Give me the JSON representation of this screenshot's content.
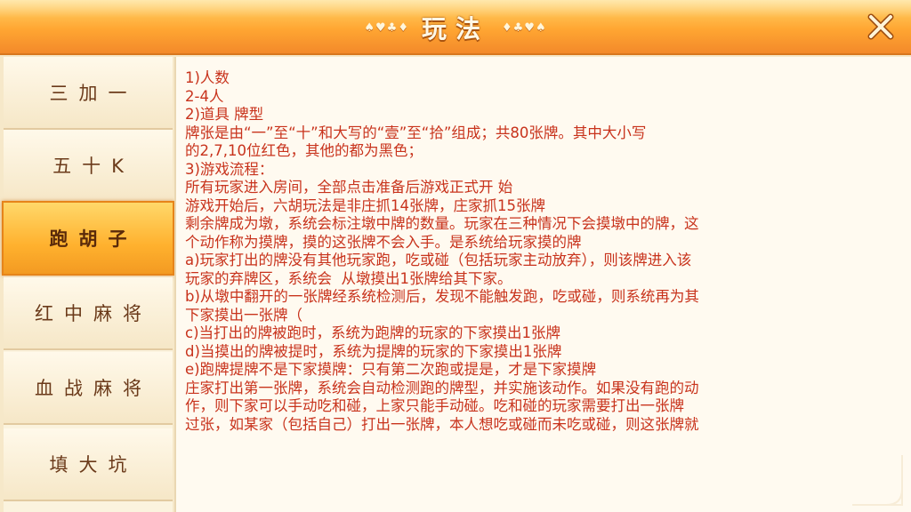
{
  "header": {
    "title": "玩法",
    "left_ornament": "♠♥♣♦",
    "right_ornament": "♦♣♥♠"
  },
  "sidebar": {
    "items": [
      {
        "label": "三加一",
        "active": false
      },
      {
        "label": "五十K",
        "active": false
      },
      {
        "label": "跑胡子",
        "active": true
      },
      {
        "label": "红中麻将",
        "active": false
      },
      {
        "label": "血战麻将",
        "active": false
      },
      {
        "label": "填大坑",
        "active": false
      }
    ]
  },
  "rules": {
    "lines": [
      "1)人数",
      "2-4人",
      "2)道具 牌型",
      "牌张是由“一”至“十”和大写的“壹”至“拾”组成；共80张牌。其中大小写",
      "的2,7,10位红色，其他的都为黑色；",
      "3)游戏流程：",
      "所有玩家进入房间，全部点击准备后游戏正式开 始",
      "游戏开始后，六胡玩法是非庄抓14张牌，庄家抓15张牌",
      "剩余牌成为墩，系统会标注墩中牌的数量。玩家在三种情况下会摸墩中的牌，这",
      "个动作称为摸牌，摸的这张牌不会入手。是系统给玩家摸的牌",
      "a)玩家打出的牌没有其他玩家跑，吃或碰（包括玩家主动放弃），则该牌进入该",
      "玩家的弃牌区，系统会  从墩摸出1张牌给其下家。",
      "b)从墩中翻开的一张牌经系统检测后，发现不能触发跑，吃或碰，则系统再为其",
      "下家摸出一张牌（",
      "c)当打出的牌被跑时，系统为跑牌的玩家的下家摸出1张牌",
      "d)当摸出的牌被提时，系统为提牌的玩家的下家摸出1张牌",
      "e)跑牌提牌不是下家摸牌：只有第二次跑或提是，才是下家摸牌",
      "庄家打出第一张牌，系统会自动检测跑的牌型，并实施该动作。如果没有跑的动",
      "作，则下家可以手动吃和碰，上家只能手动碰。吃和碰的玩家需要打出一张牌",
      "过张，如某家（包括自己）打出一张牌，本人想吃或碰而未吃或碰，则这张牌就"
    ]
  },
  "colors": {
    "rule_text": "#c8331c",
    "header_orange": "#ffa632",
    "active_tab": "#ffb12e",
    "tab_text": "#6b3a1a"
  }
}
